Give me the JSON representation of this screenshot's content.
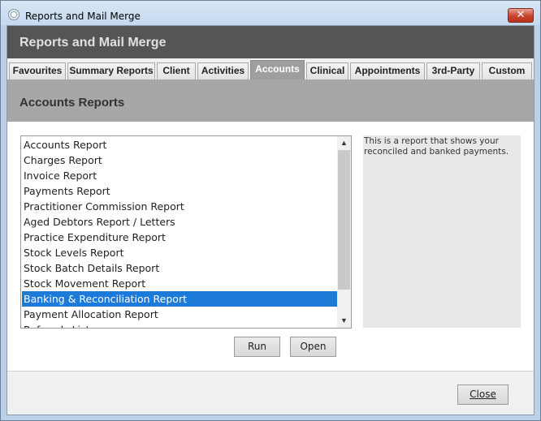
{
  "window": {
    "title": "Reports and Mail Merge",
    "close_glyph": "✕"
  },
  "header": {
    "title": "Reports and Mail Merge"
  },
  "tabs": [
    {
      "label": "Favourites"
    },
    {
      "label": "Summary Reports"
    },
    {
      "label": "Client"
    },
    {
      "label": "Activities"
    },
    {
      "label": "Accounts",
      "active": true
    },
    {
      "label": "Clinical"
    },
    {
      "label": "Appointments"
    },
    {
      "label": "3rd-Party"
    },
    {
      "label": "Custom"
    }
  ],
  "section": {
    "title": "Accounts Reports"
  },
  "reports": {
    "items": [
      "Accounts Report",
      "Charges Report",
      "Invoice Report",
      "Payments Report",
      "Practitioner Commission Report",
      "Aged Debtors Report / Letters",
      "Practice Expenditure Report",
      "Stock Levels Report",
      "Stock Batch Details Report",
      "Stock Movement Report",
      "Banking & Reconciliation Report",
      "Payment Allocation Report",
      "Referrals List"
    ],
    "selected_index": 10
  },
  "description": {
    "text": "This is a report that shows your reconciled and banked payments."
  },
  "buttons": {
    "run": "Run",
    "open": "Open",
    "close": "Close"
  },
  "icons": {
    "app": "app-icon",
    "scroll_up": "chevron-up-icon",
    "scroll_down": "chevron-down-icon"
  }
}
